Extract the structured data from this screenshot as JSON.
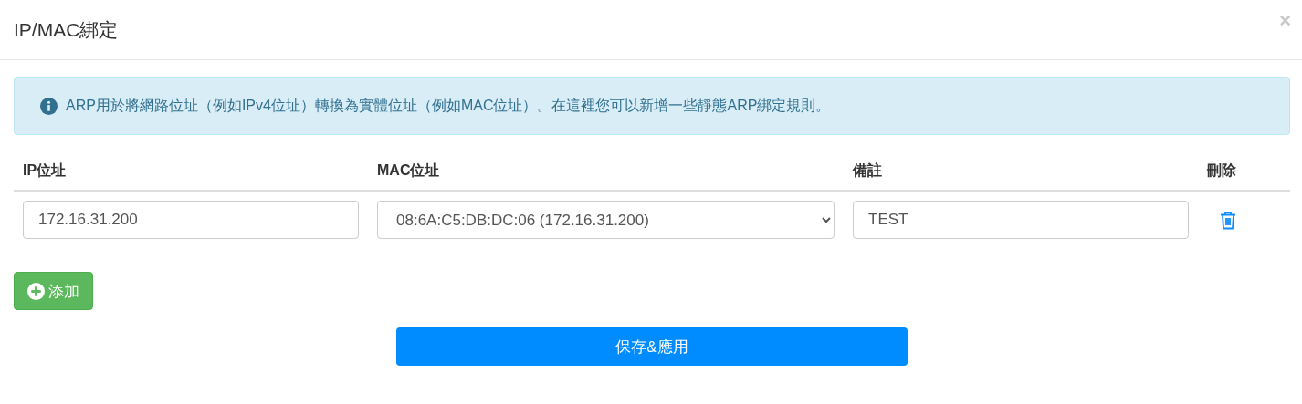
{
  "dialog": {
    "title": "IP/MAC綁定",
    "close": "×"
  },
  "alert": {
    "text": "ARP用於將網路位址（例如IPv4位址）轉換為實體位址（例如MAC位址）。在這裡您可以新增一些靜態ARP綁定規則。"
  },
  "table": {
    "columns": [
      "IP位址",
      "MAC位址",
      "備註",
      "刪除"
    ],
    "rows": [
      {
        "ip": "172.16.31.200",
        "mac": "08:6A:C5:DB:DC:06 (172.16.31.200)",
        "note": "TEST"
      }
    ]
  },
  "add_button": "添加",
  "save_button": "保存&應用"
}
